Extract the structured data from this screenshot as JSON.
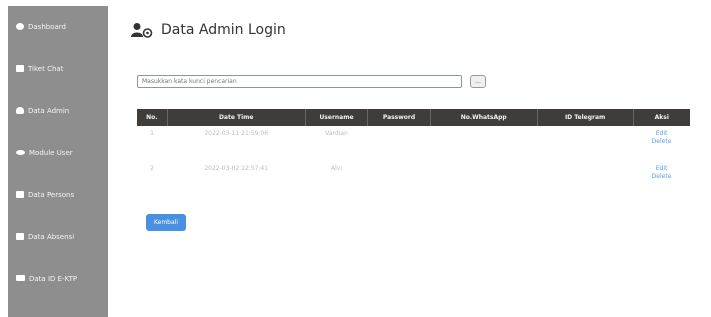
{
  "sidebar": {
    "items": [
      {
        "label": "Dashboard",
        "icon": "dashboard-icon"
      },
      {
        "label": "Tiket Chat",
        "icon": "document-icon"
      },
      {
        "label": "Data Admin",
        "icon": "user-icon"
      },
      {
        "label": "Module User",
        "icon": "eye-icon"
      },
      {
        "label": "Data Persons",
        "icon": "file-icon"
      },
      {
        "label": "Data Absensi",
        "icon": "file-icon"
      },
      {
        "label": "Data ID E-KTP",
        "icon": "card-icon"
      }
    ]
  },
  "header": {
    "title": "Data Admin Login"
  },
  "search": {
    "placeholder": "Masukkan kata kunci pencarian",
    "button_label": "..."
  },
  "table": {
    "columns": [
      "No.",
      "Date Time",
      "Username",
      "Password",
      "No.WhatsApp",
      "ID Telegram",
      "Aksi"
    ],
    "rows": [
      {
        "no": "1",
        "date_time": "2022-03-11 21:59:06",
        "username": "Vardian",
        "password": "",
        "whatsapp": "",
        "telegram": "",
        "edit": "Edit",
        "delete": "Delete"
      },
      {
        "no": "2",
        "date_time": "2022-03-02 12:57:41",
        "username": "Alvi",
        "password": "",
        "whatsapp": "",
        "telegram": "",
        "edit": "Edit",
        "delete": "Delete"
      }
    ]
  },
  "back_button": {
    "label": "Kembali"
  },
  "colors": {
    "sidebar": "#8e8e8e",
    "header": "#3f3c3a",
    "link": "#5aa0e0",
    "button": "#4a90e2"
  }
}
